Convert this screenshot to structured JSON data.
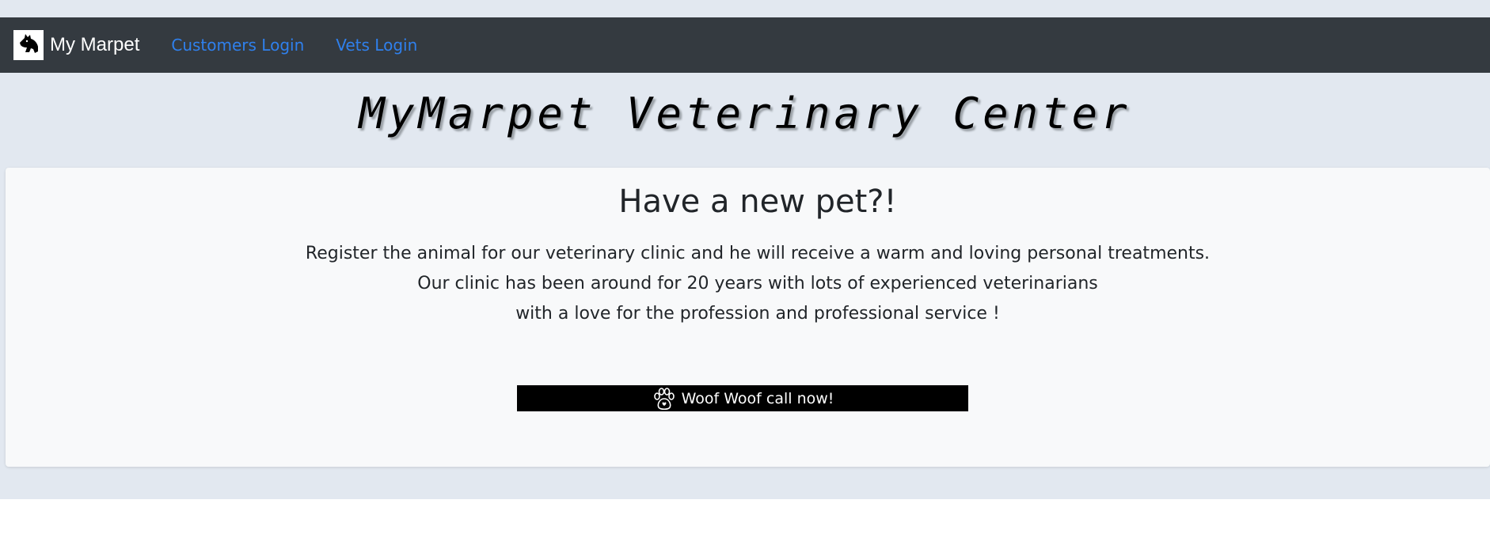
{
  "navbar": {
    "brand_name": "My Marpet",
    "logo_icon": "dog-head-icon",
    "links": [
      {
        "label": "Customers Login"
      },
      {
        "label": "Vets Login"
      }
    ],
    "link_color": "#2f80ed",
    "background": "#343a40"
  },
  "hero": {
    "title": "MyMarpet Veterinary Center"
  },
  "card": {
    "heading": "Have a new pet?!",
    "lines": [
      "Register the animal for our veterinary clinic and he will receive a warm and loving personal treatments.",
      "Our clinic has been around for 20 years with lots of experienced veterinarians",
      "with a love for the profession and professional service !"
    ],
    "button": {
      "label": "Woof Woof call now!",
      "icon": "paw-icon"
    }
  },
  "colors": {
    "page_background": "#e2e8f0",
    "card_background": "#f8f9fa",
    "button_background": "#000000"
  }
}
